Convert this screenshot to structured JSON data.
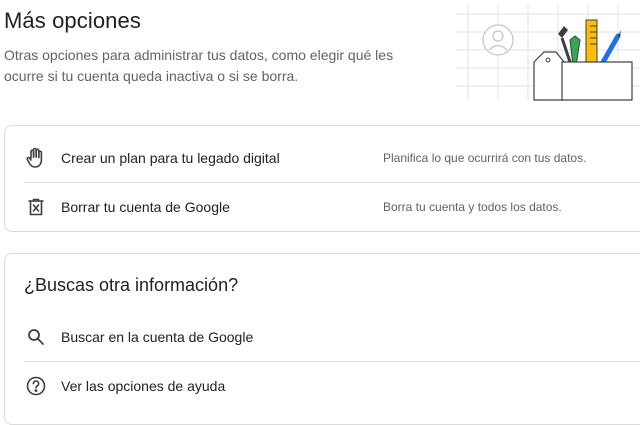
{
  "header": {
    "title": "Más opciones",
    "description": "Otras opciones para administrar tus datos, como elegir qué les ocurre si tu cuenta queda inactiva o si se borra."
  },
  "options": [
    {
      "icon": "hand-icon",
      "label": "Crear un plan para tu legado digital",
      "description": "Planifica lo que ocurrirá con tus datos."
    },
    {
      "icon": "delete-account-icon",
      "label": "Borrar tu cuenta de Google",
      "description": "Borra tu cuenta y todos los datos."
    }
  ],
  "more_info": {
    "heading": "¿Buscas otra información?",
    "items": [
      {
        "icon": "search-icon",
        "label": "Buscar en la cuenta de Google"
      },
      {
        "icon": "help-icon",
        "label": "Ver las opciones de ayuda"
      }
    ]
  },
  "colors": {
    "text_primary": "#202124",
    "text_secondary": "#5f6368",
    "border": "#dadce0",
    "accent_blue": "#1a73e8",
    "accent_yellow": "#fbbc04",
    "accent_green": "#34a853",
    "accent_red": "#ea4335"
  }
}
